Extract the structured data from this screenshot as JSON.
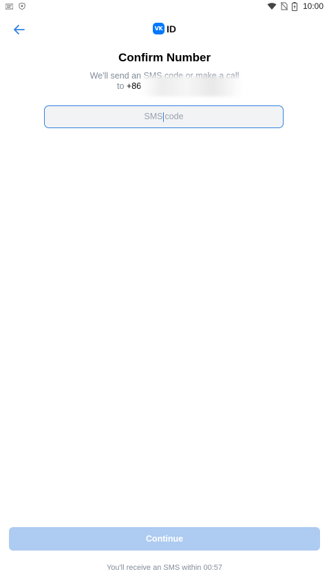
{
  "status_bar": {
    "time": "10:00",
    "left_icons": [
      "notification-icon",
      "shield-icon"
    ],
    "right_icons": [
      "wifi-icon",
      "no-sim-icon",
      "battery-icon"
    ]
  },
  "header": {
    "back_icon": "arrow-left-icon",
    "logo_badge": "VK",
    "logo_text": "ID",
    "accent_color": "#0077ff"
  },
  "title": "Confirm Number",
  "subtitle": {
    "line1": "We'll send an SMS code or make a call",
    "prefix": "to",
    "phone": "+86"
  },
  "sms_input": {
    "placeholder_before_cursor": "SMS",
    "placeholder_after_cursor": "code",
    "border_color": "#2d81e0"
  },
  "continue_button": {
    "label": "Continue",
    "color": "#aecbf1",
    "enabled": false
  },
  "timer": {
    "text": "You'll receive an SMS within 00:57"
  }
}
